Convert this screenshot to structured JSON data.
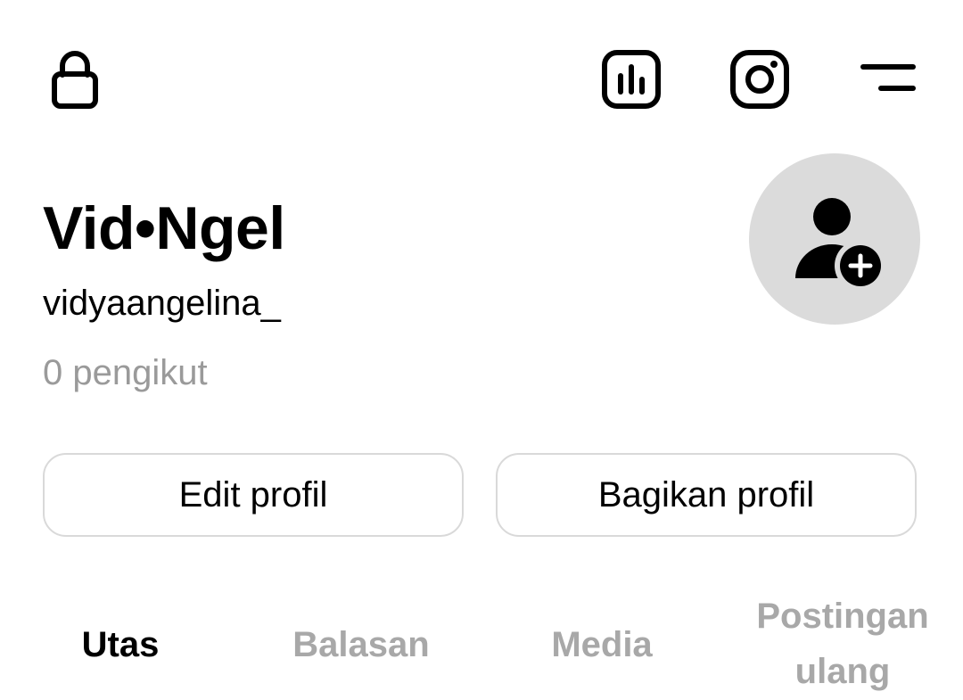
{
  "topbar": {
    "lock_icon": "lock-icon",
    "insights_icon": "insights-icon",
    "instagram_icon": "instagram-icon",
    "menu_icon": "menu-icon"
  },
  "profile": {
    "display_name": "Vid•Ngel",
    "username": "vidyaangelina_",
    "followers": "0 pengikut",
    "avatar_icon": "add-person-icon"
  },
  "actions": {
    "edit_label": "Edit profil",
    "share_label": "Bagikan profil"
  },
  "tabs": [
    {
      "label": "Utas",
      "active": true
    },
    {
      "label": "Balasan",
      "active": false
    },
    {
      "label": "Media",
      "active": false
    },
    {
      "label": "Postingan ulang",
      "active": false
    }
  ],
  "colors": {
    "inactive_text": "#a8a8a8",
    "avatar_bg": "#dbdbdb",
    "border": "#d9d9d9"
  }
}
